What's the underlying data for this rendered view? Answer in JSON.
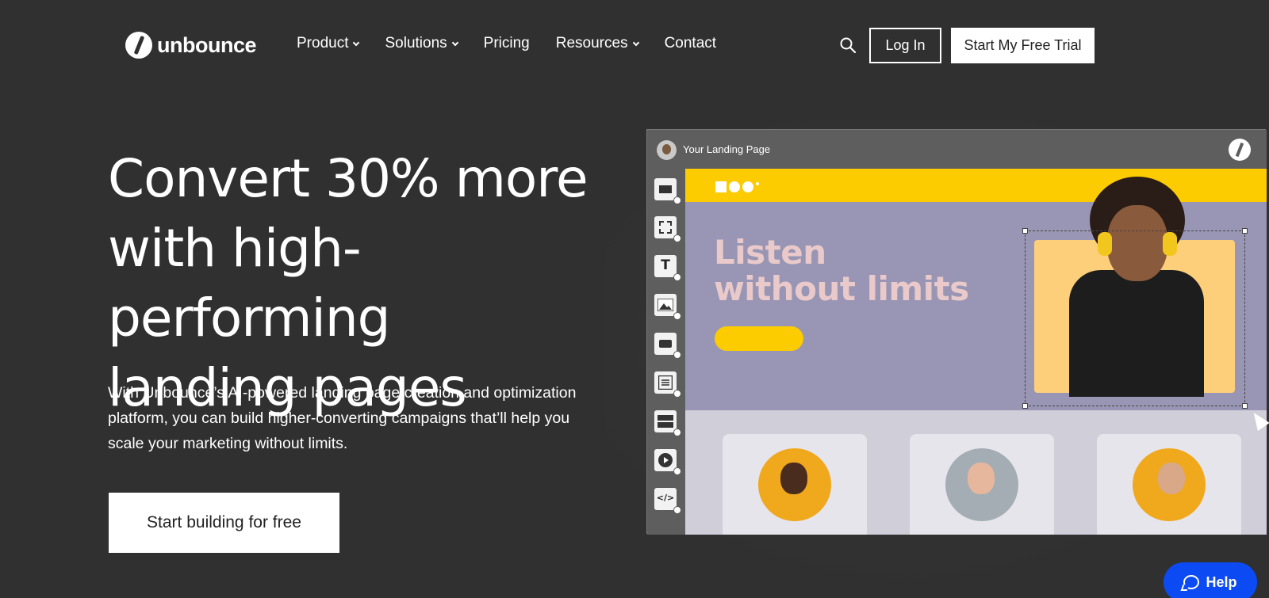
{
  "brand": {
    "logo_text": "unbounce"
  },
  "nav": {
    "items": [
      {
        "label": "Product",
        "has_dropdown": true
      },
      {
        "label": "Solutions",
        "has_dropdown": true
      },
      {
        "label": "Pricing",
        "has_dropdown": false
      },
      {
        "label": "Resources",
        "has_dropdown": true
      },
      {
        "label": "Contact",
        "has_dropdown": false
      }
    ],
    "search_icon": "search-icon",
    "login_label": "Log In",
    "trial_label": "Start My Free Trial"
  },
  "hero": {
    "title_lines": [
      "Convert 30% more",
      "with high-performing",
      "landing pages"
    ],
    "subtitle": "With Unbounce’s AI-powered landing page creation and optimization platform, you can build higher-converting campaigns that’ll help you scale your marketing without limits.",
    "cta_label": "Start building for free"
  },
  "editor": {
    "title": "Your Landing Page",
    "tools": [
      "section-icon",
      "box-icon",
      "text-icon",
      "image-icon",
      "button-icon",
      "form-icon",
      "list-icon",
      "video-icon",
      "code-icon"
    ],
    "text_tool_glyph": "T",
    "code_tool_glyph": "</>",
    "canvas": {
      "headline_lines": [
        "Listen",
        "without limits"
      ],
      "accent_color": "#fccb00",
      "background_color": "#9896b4"
    }
  },
  "help": {
    "label": "Help"
  },
  "colors": {
    "page_bg": "#303030",
    "help_bg": "#0c4bf4"
  }
}
